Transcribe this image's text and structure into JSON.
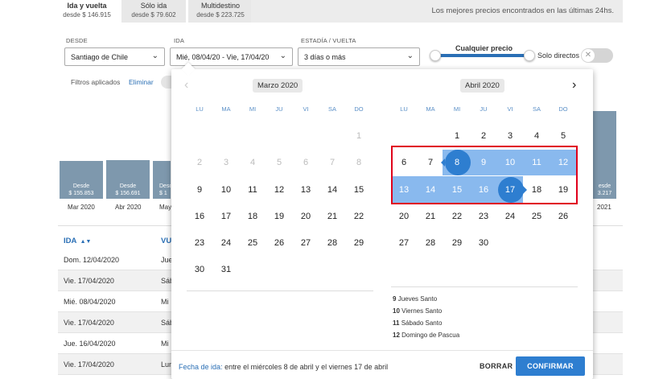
{
  "tabs": [
    {
      "label": "Ida y vuelta",
      "price": "desde $ 146.915"
    },
    {
      "label": "Sólo ida",
      "price": "desde $ 79.602"
    },
    {
      "label": "Multidestino",
      "price": "desde $ 223.725"
    }
  ],
  "best_prices_note": "Los mejores precios encontrados en las últimas 24hs.",
  "filters": {
    "from_label": "DESDE",
    "from_value": "Santiago de Chile",
    "dates_label": "IDA",
    "dates_value": "Mié, 08/04/20 - Vie, 17/04/20",
    "stay_label": "ESTADÍA / VUELTA",
    "stay_value": "3 días o más",
    "price_label": "Cualquier precio",
    "direct_label": "Solo directos",
    "applied_label": "Filtros aplicados",
    "clear_label": "Eliminar"
  },
  "background_chart": {
    "bars": [
      {
        "line1": "Desde",
        "line2": "$ 155.853",
        "month": "Mar 2020"
      },
      {
        "line1": "Desde",
        "line2": "$ 156.691",
        "month": "Abr 2020"
      },
      {
        "line1": "Desde",
        "line2": "$ 1",
        "month": "May"
      },
      {
        "line1": "esde",
        "line2": "3.217",
        "month": "2021"
      }
    ]
  },
  "table": {
    "col1_header": "IDA",
    "col2_header": "VU",
    "rows": [
      {
        "ida": "Dom. 12/04/2020",
        "vuelta": "Jue"
      },
      {
        "ida": "Vie. 17/04/2020",
        "vuelta": "Sáb"
      },
      {
        "ida": "Mié. 08/04/2020",
        "vuelta": "Mi"
      },
      {
        "ida": "Vie. 17/04/2020",
        "vuelta": "Sáb"
      },
      {
        "ida": "Jue. 16/04/2020",
        "vuelta": "Mi"
      },
      {
        "ida": "Vie. 17/04/2020",
        "vuelta": "Lun"
      }
    ]
  },
  "calendar": {
    "weekdays": [
      "LU",
      "MA",
      "MI",
      "JU",
      "VI",
      "SA",
      "DO"
    ],
    "left_month": "Marzo 2020",
    "right_month": "Abril 2020",
    "march_weeks": [
      [
        "",
        "",
        "",
        "",
        "",
        "",
        "1"
      ],
      [
        "2",
        "3",
        "4",
        "5",
        "6",
        "7",
        "8"
      ],
      [
        "9",
        "10",
        "11",
        "12",
        "13",
        "14",
        "15"
      ],
      [
        "16",
        "17",
        "18",
        "19",
        "20",
        "21",
        "22"
      ],
      [
        "23",
        "24",
        "25",
        "26",
        "27",
        "28",
        "29"
      ],
      [
        "30",
        "31",
        "",
        "",
        "",
        "",
        ""
      ]
    ],
    "april_weeks": [
      [
        "",
        "",
        "1",
        "2",
        "3",
        "4",
        "5"
      ],
      [
        "6",
        "7",
        "8",
        "9",
        "10",
        "11",
        "12"
      ],
      [
        "13",
        "14",
        "15",
        "16",
        "17",
        "18",
        "19"
      ],
      [
        "20",
        "21",
        "22",
        "23",
        "24",
        "25",
        "26"
      ],
      [
        "27",
        "28",
        "29",
        "30",
        "",
        "",
        ""
      ]
    ],
    "holidays": [
      {
        "day": "9",
        "name": "Jueves Santo"
      },
      {
        "day": "10",
        "name": "Viernes Santo"
      },
      {
        "day": "11",
        "name": "Sábado Santo"
      },
      {
        "day": "12",
        "name": "Domingo de Pascua"
      }
    ],
    "range_color": "#89b9ee",
    "endpoint_color": "#2e7ed0",
    "highlight_color": "#e0001b"
  },
  "footer": {
    "label": "Fecha de ida:",
    "text": "entre el miércoles 8 de abril y el viernes 17 de abril",
    "clear_button": "BORRAR",
    "confirm_button": "CONFIRMAR"
  }
}
